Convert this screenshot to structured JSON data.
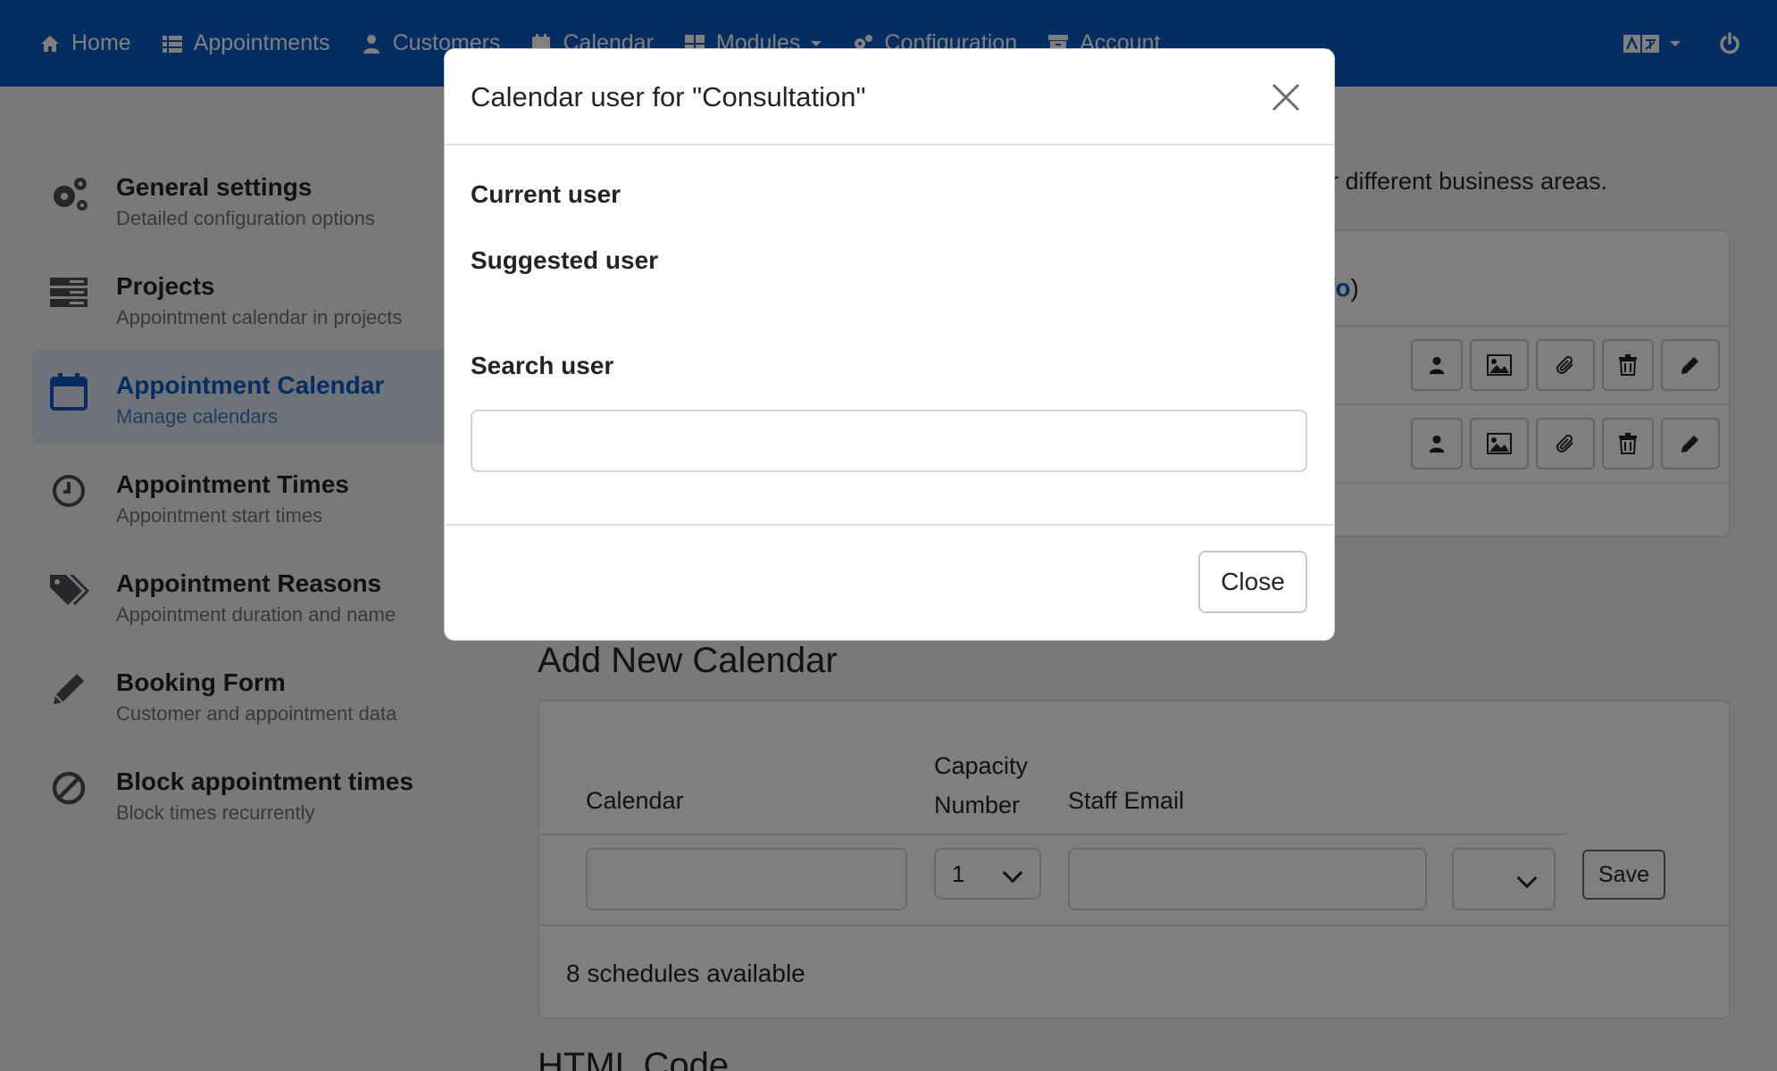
{
  "nav": {
    "items": [
      {
        "label": "Home",
        "icon": "home-icon"
      },
      {
        "label": "Appointments",
        "icon": "list-icon"
      },
      {
        "label": "Customers",
        "icon": "user-icon"
      },
      {
        "label": "Calendar",
        "icon": "calendar-icon"
      },
      {
        "label": "Modules",
        "icon": "grid-icon"
      },
      {
        "label": "Configuration",
        "icon": "gears-icon"
      },
      {
        "label": "Account",
        "icon": "archive-icon"
      }
    ]
  },
  "sidebar": {
    "items": [
      {
        "title": "General settings",
        "subtitle": "Detailed configuration options"
      },
      {
        "title": "Projects",
        "subtitle": "Appointment calendar in projects"
      },
      {
        "title": "Appointment Calendar",
        "subtitle": "Manage calendars"
      },
      {
        "title": "Appointment Times",
        "subtitle": "Appointment start times"
      },
      {
        "title": "Appointment Reasons",
        "subtitle": "Appointment duration and name"
      },
      {
        "title": "Booking Form",
        "subtitle": "Customer and appointment data"
      },
      {
        "title": "Block appointment times",
        "subtitle": "Block times recurrently"
      }
    ]
  },
  "main": {
    "intro_fragment": "r different business areas.",
    "info_link_fragment": "fo",
    "info_close": ")",
    "add_heading": "Add New Calendar",
    "columns": {
      "calendar": "Calendar",
      "capacity": "Capacity Number",
      "staff_email": "Staff Email"
    },
    "capacity_value": "1",
    "save_label": "Save",
    "schedules_text": "8 schedules available",
    "html_heading": "HTML Code"
  },
  "modal": {
    "title": "Calendar user for \"Consultation\"",
    "current_user_label": "Current user",
    "suggested_user_label": "Suggested user",
    "search_user_label": "Search user",
    "search_value": "",
    "close_label": "Close"
  }
}
